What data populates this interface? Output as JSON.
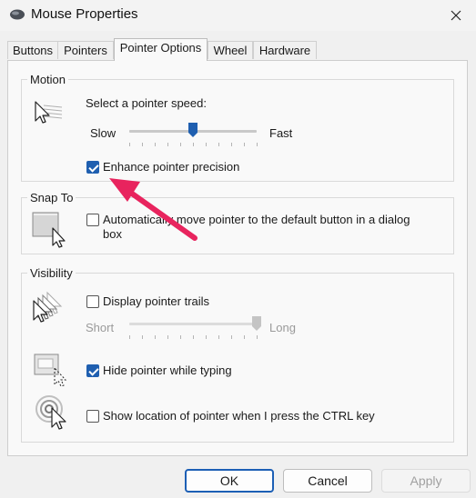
{
  "window": {
    "title": "Mouse Properties"
  },
  "tabs": [
    {
      "label": "Buttons",
      "active": false
    },
    {
      "label": "Pointers",
      "active": false
    },
    {
      "label": "Pointer Options",
      "active": true
    },
    {
      "label": "Wheel",
      "active": false
    },
    {
      "label": "Hardware",
      "active": false
    }
  ],
  "motion": {
    "group_label": "Motion",
    "speed_label": "Select a pointer speed:",
    "slow_label": "Slow",
    "fast_label": "Fast",
    "speed_level": 0.5,
    "enhance_precision": {
      "label": "Enhance pointer precision",
      "checked": true
    }
  },
  "snap_to": {
    "group_label": "Snap To",
    "option": {
      "label_line1": "Automatically move pointer to the default button in a dialog",
      "label_line2": "box",
      "checked": false
    }
  },
  "visibility": {
    "group_label": "Visibility",
    "trails": {
      "label": "Display pointer trails",
      "checked": false
    },
    "trail_short_label": "Short",
    "trail_long_label": "Long",
    "trail_level": 1.0,
    "hide_typing": {
      "label": "Hide pointer while typing",
      "checked": true
    },
    "show_location": {
      "label": "Show location of pointer when I press the CTRL key",
      "checked": false
    }
  },
  "buttons": {
    "ok": "OK",
    "cancel": "Cancel",
    "apply": "Apply"
  },
  "colors": {
    "accent": "#1f5fb0",
    "annotation_arrow": "#e8245e"
  },
  "icons": [
    "mouse-icon",
    "close-icon",
    "pointer-speed-icon",
    "snap-to-icon",
    "pointer-trails-icon",
    "hide-pointer-icon",
    "pointer-location-icon",
    "annotation-arrow"
  ]
}
